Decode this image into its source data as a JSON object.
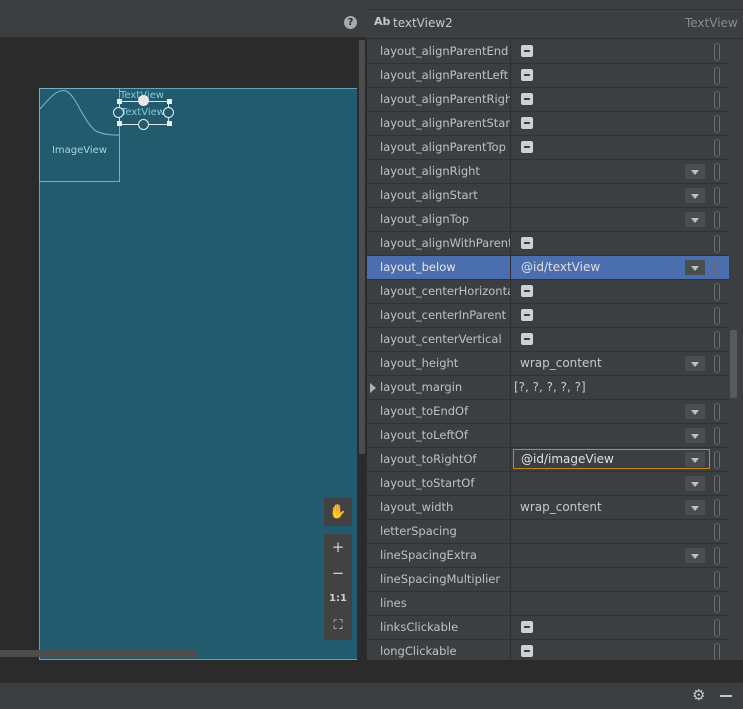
{
  "design": {
    "help_symbol": "?",
    "imageview_label": "ImageView",
    "textview_ghost_label": "TextView",
    "textview_selected_label": "TextView",
    "zoom": {
      "pan_icon": "✋",
      "zoom_in": "+",
      "zoom_out": "−",
      "actual_size": "1:1",
      "fit_icon": "⛶"
    }
  },
  "attributes": {
    "header": {
      "ab_icon": "Ab",
      "widget_id": "textView2",
      "widget_type": "TextView"
    },
    "rows": [
      {
        "name": "layout_alignParentEnd",
        "kind": "check"
      },
      {
        "name": "layout_alignParentLeft",
        "kind": "check"
      },
      {
        "name": "layout_alignParentRight",
        "kind": "check"
      },
      {
        "name": "layout_alignParentStart",
        "kind": "check"
      },
      {
        "name": "layout_alignParentTop",
        "kind": "check"
      },
      {
        "name": "layout_alignRight",
        "kind": "dropdown"
      },
      {
        "name": "layout_alignStart",
        "kind": "dropdown"
      },
      {
        "name": "layout_alignTop",
        "kind": "dropdown"
      },
      {
        "name": "layout_alignWithParentIf...",
        "kind": "check"
      },
      {
        "name": "layout_below",
        "kind": "edit",
        "value": "@id/textView",
        "selected": true
      },
      {
        "name": "layout_centerHorizontal",
        "kind": "check"
      },
      {
        "name": "layout_centerInParent",
        "kind": "check"
      },
      {
        "name": "layout_centerVertical",
        "kind": "check"
      },
      {
        "name": "layout_height",
        "kind": "dropdown",
        "value": "wrap_content"
      },
      {
        "name": "layout_margin",
        "kind": "text",
        "value": "[?, ?, ?, ?, ?]",
        "expandable": true
      },
      {
        "name": "layout_toEndOf",
        "kind": "dropdown"
      },
      {
        "name": "layout_toLeftOf",
        "kind": "dropdown"
      },
      {
        "name": "layout_toRightOf",
        "kind": "edit-orange",
        "value": "@id/imageView"
      },
      {
        "name": "layout_toStartOf",
        "kind": "dropdown"
      },
      {
        "name": "layout_width",
        "kind": "dropdown",
        "value": "wrap_content"
      },
      {
        "name": "letterSpacing",
        "kind": "text"
      },
      {
        "name": "lineSpacingExtra",
        "kind": "dropdown"
      },
      {
        "name": "lineSpacingMultiplier",
        "kind": "text"
      },
      {
        "name": "lines",
        "kind": "text"
      },
      {
        "name": "linksClickable",
        "kind": "check"
      },
      {
        "name": "longClickable",
        "kind": "check"
      }
    ]
  },
  "colors": {
    "selection": "#4b6eaf",
    "focus_orange": "#c7871f",
    "device_bg": "#225a6e"
  }
}
